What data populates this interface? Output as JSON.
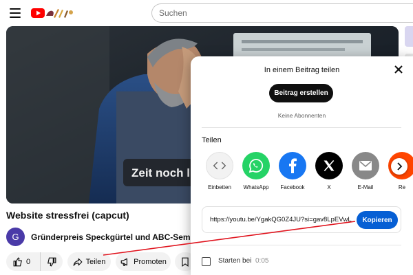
{
  "search": {
    "placeholder": "Suchen"
  },
  "video": {
    "overlay_text": "Zeit noch l",
    "title": "Website stressfrei (capcut)",
    "channel": {
      "avatar_letter": "G",
      "name": "Gründerpreis Speckgürtel und ABC-Seminare"
    }
  },
  "actions": {
    "likes": "0",
    "share": "Teilen",
    "promote": "Promoten"
  },
  "share_dialog": {
    "header": "In einem Beitrag teilen",
    "create_post": "Beitrag erstellen",
    "no_subscribers": "Keine Abonnenten",
    "share_heading": "Teilen",
    "targets": [
      {
        "label": "Einbetten",
        "icon": "embed-icon",
        "color": "#f2f2f2"
      },
      {
        "label": "WhatsApp",
        "icon": "whatsapp-icon",
        "color": "#25d366"
      },
      {
        "label": "Facebook",
        "icon": "facebook-icon",
        "color": "#1877f2"
      },
      {
        "label": "X",
        "icon": "x-icon",
        "color": "#000000"
      },
      {
        "label": "E-Mail",
        "icon": "email-icon",
        "color": "#888888"
      },
      {
        "label": "Re",
        "icon": "reddit-icon",
        "color": "#ff4500"
      }
    ],
    "url": "https://youtu.be/YgakQG0Z4JU?si=gav8LpEVwL",
    "copy": "Kopieren",
    "start_label": "Starten bei",
    "start_time": "0:05"
  },
  "colors": {
    "accent_blue": "#065fd4",
    "annotation_red": "#e0141e",
    "youtube_red": "#ff0000"
  }
}
